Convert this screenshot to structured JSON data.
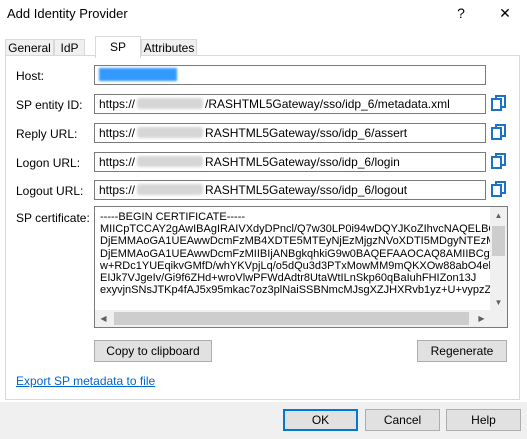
{
  "window": {
    "title": "Add Identity Provider",
    "help_glyph": "?",
    "close_glyph": "✕"
  },
  "tabs": [
    {
      "label": "General",
      "active": false
    },
    {
      "label": "IdP",
      "active": false
    },
    {
      "label": "SP",
      "active": true
    },
    {
      "label": "Attributes",
      "active": false
    }
  ],
  "sp": {
    "host_label": "Host:",
    "entity_id_label": "SP entity ID:",
    "entity_id_prefix": "https://",
    "entity_id_suffix": "/RASHTML5Gateway/sso/idp_6/metadata.xml",
    "reply_url_label": "Reply URL:",
    "reply_url_prefix": "https://",
    "reply_url_suffix": "RASHTML5Gateway/sso/idp_6/assert",
    "logon_url_label": "Logon URL:",
    "logon_url_prefix": "https://",
    "logon_url_suffix": "RASHTML5Gateway/sso/idp_6/login",
    "logout_url_label": "Logout URL:",
    "logout_url_prefix": "https://",
    "logout_url_suffix": "RASHTML5Gateway/sso/idp_6/logout",
    "certificate_label": "SP certificate:",
    "certificate_text": "-----BEGIN CERTIFICATE-----\nMIICpTCCAY2gAwIBAgIRAIVXdyDPncl/Q7w30LP0i94wDQYJKoZIhvcNAQELBQAw\nDjEMMAoGA1UEAwwDcmFzMB4XDTE5MTEyNjEzMjgzNVoXDTI5MDgyNTEzMjgzNV\nDjEMMAoGA1UEAwwDcmFzMIIBIjANBgkqhkiG9w0BAQEFAAOCAQ8AMIIBCgKCAQ\nw+RDc1YUEqikvGMfD/whYKVpjLq/o5dQu3d3PTxMowMM9mQKXOw88abO4ekV0o\nEIJk7VJgeIv/Gi9f6ZHd+wroVlwPFWdAdtr8UtaWtILnSkp60qBaIuhFHIZon13J\nexyvjnSNsJTKp4fAJ5x95mkac7oz3plNaiSSBNmcMJsgXZJHXRvb1yz+U+vypzZh"
  },
  "buttons": {
    "copy_to_clipboard": "Copy to clipboard",
    "regenerate": "Regenerate",
    "ok": "OK",
    "cancel": "Cancel",
    "help": "Help"
  },
  "export_link": "Export SP metadata to file",
  "colors": {
    "accent": "#0078d7",
    "link": "#0066cc",
    "selection": "#3399ff",
    "copy_icon": "#1a73c8"
  }
}
